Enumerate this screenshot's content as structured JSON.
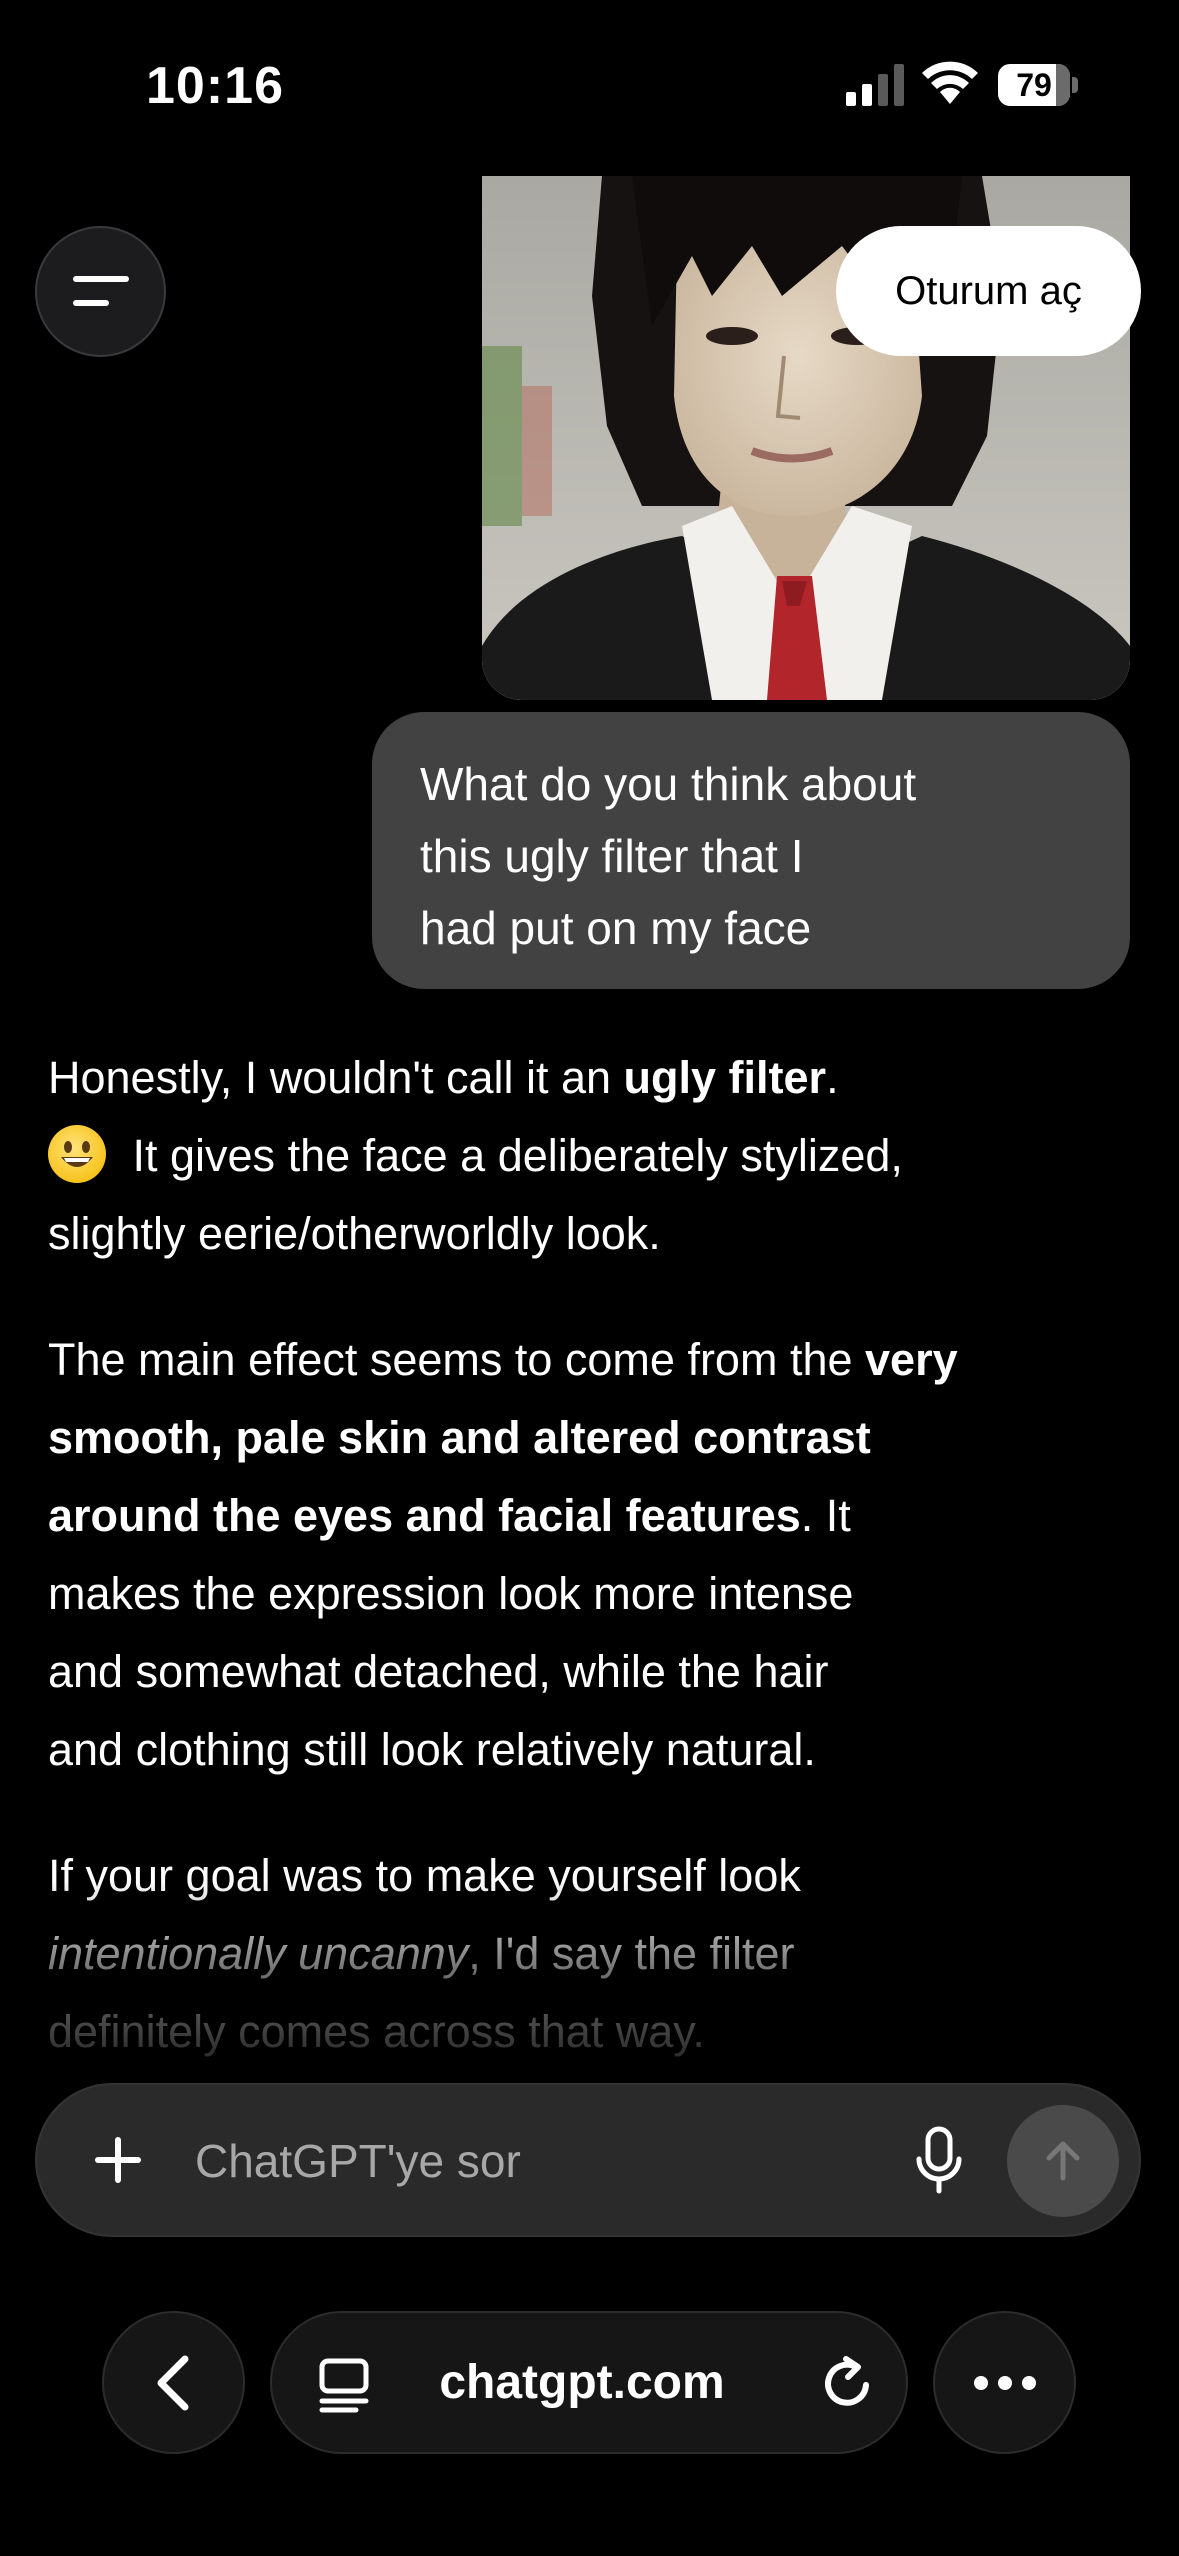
{
  "status_bar": {
    "time": "10:16",
    "battery_level": "79"
  },
  "header": {
    "login_label": "Oturum aç"
  },
  "conversation": {
    "user_message_lines": [
      "What do you think about",
      "this ugly filter that I",
      "had put on my face"
    ],
    "response": {
      "p1": {
        "l1_a": "Honestly, I wouldn't call it an ",
        "l1_b": "ugly filter",
        "l1_c": ".",
        "l2": " It gives the face a deliberately stylized,",
        "l3": "slightly eerie/otherworldly look."
      },
      "p2": {
        "l1_a": "The main effect seems to come from the ",
        "l1_b": "very",
        "l2": "smooth, pale skin and altered contrast",
        "l3_a": "around the eyes and facial features",
        "l3_b": ". It",
        "l4": "makes the expression look more intense",
        "l5": "and somewhat detached, while the hair",
        "l6": "and clothing still look relatively natural."
      },
      "p3": {
        "l1": "If your goal was to make yourself look",
        "l2_a": "intentionally uncanny",
        "l2_b": ", I'd say the filter",
        "l3": "definitely comes across that way."
      }
    }
  },
  "composer": {
    "placeholder": "ChatGPT'ye sor"
  },
  "browser": {
    "url": "chatgpt.com"
  },
  "icons": {
    "menu": "menu-icon",
    "plus": "plus-icon",
    "mic": "microphone-icon",
    "send": "arrow-up-icon",
    "back": "chevron-left-icon",
    "reader": "reader-mode-icon",
    "reload": "reload-icon",
    "more": "ellipsis-icon",
    "emoji": "grinning-face-emoji"
  }
}
